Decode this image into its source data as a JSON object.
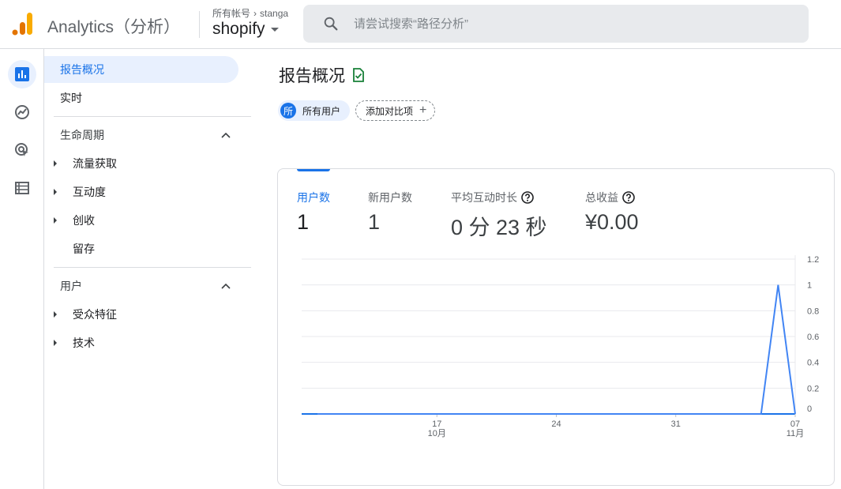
{
  "app": {
    "title": "Analytics（分析）"
  },
  "account": {
    "breadcrumb_root": "所有帐号",
    "breadcrumb_account": "stanga",
    "property": "shopify"
  },
  "search": {
    "placeholder": "请尝试搜索“路径分析”"
  },
  "rail": {
    "icons": [
      "reports-icon",
      "explore-icon",
      "advertising-icon",
      "configure-icon"
    ]
  },
  "nav": {
    "reports_snapshot": "报告概况",
    "realtime": "实时",
    "lifecycle": {
      "title": "生命周期",
      "items": [
        "流量获取",
        "互动度",
        "创收",
        "留存"
      ]
    },
    "user": {
      "title": "用户",
      "items": [
        "受众特征",
        "技术"
      ]
    }
  },
  "page": {
    "title": "报告概况"
  },
  "comparison": {
    "badge": "所",
    "user_chip": "所有用户",
    "add_chip": "添加对比项"
  },
  "metrics": [
    {
      "label": "用户数",
      "value": "1"
    },
    {
      "label": "新用户数",
      "value": "1"
    },
    {
      "label": "平均互动时长",
      "value": "0 分 23 秒"
    },
    {
      "label": "总收益",
      "value": "¥0.00"
    }
  ],
  "colors": {
    "accent": "#1a73e8",
    "logo_orange": "#f9ab00",
    "logo_dark_orange": "#e37400"
  },
  "chart_data": {
    "type": "line",
    "series": [
      {
        "values": [
          0,
          0,
          0,
          0,
          0,
          0,
          0,
          0,
          0,
          0,
          0,
          0,
          0,
          0,
          0,
          0,
          0,
          0,
          0,
          0,
          0,
          0,
          0,
          0,
          0,
          0,
          0,
          1,
          0
        ]
      }
    ],
    "x": [
      "10/10",
      "10/11",
      "10/12",
      "10/13",
      "10/14",
      "10/15",
      "10/16",
      "10/17",
      "10/18",
      "10/19",
      "10/20",
      "10/21",
      "10/22",
      "10/23",
      "10/24",
      "10/25",
      "10/26",
      "10/27",
      "10/28",
      "10/29",
      "10/30",
      "10/31",
      "11/01",
      "11/02",
      "11/03",
      "11/04",
      "11/05",
      "11/06",
      "11/07"
    ],
    "x_ticks": [
      {
        "label": "17",
        "sublabel": "10月",
        "index": 7
      },
      {
        "label": "24",
        "sublabel": "",
        "index": 14
      },
      {
        "label": "31",
        "sublabel": "",
        "index": 21
      },
      {
        "label": "07",
        "sublabel": "11月",
        "index": 28
      }
    ],
    "y_ticks": [
      "1.2",
      "1",
      "0.8",
      "0.6",
      "0.4",
      "0.2",
      "0"
    ],
    "ylim": [
      0,
      1.2
    ],
    "grid": true,
    "title": "",
    "xlabel": "",
    "ylabel": ""
  }
}
